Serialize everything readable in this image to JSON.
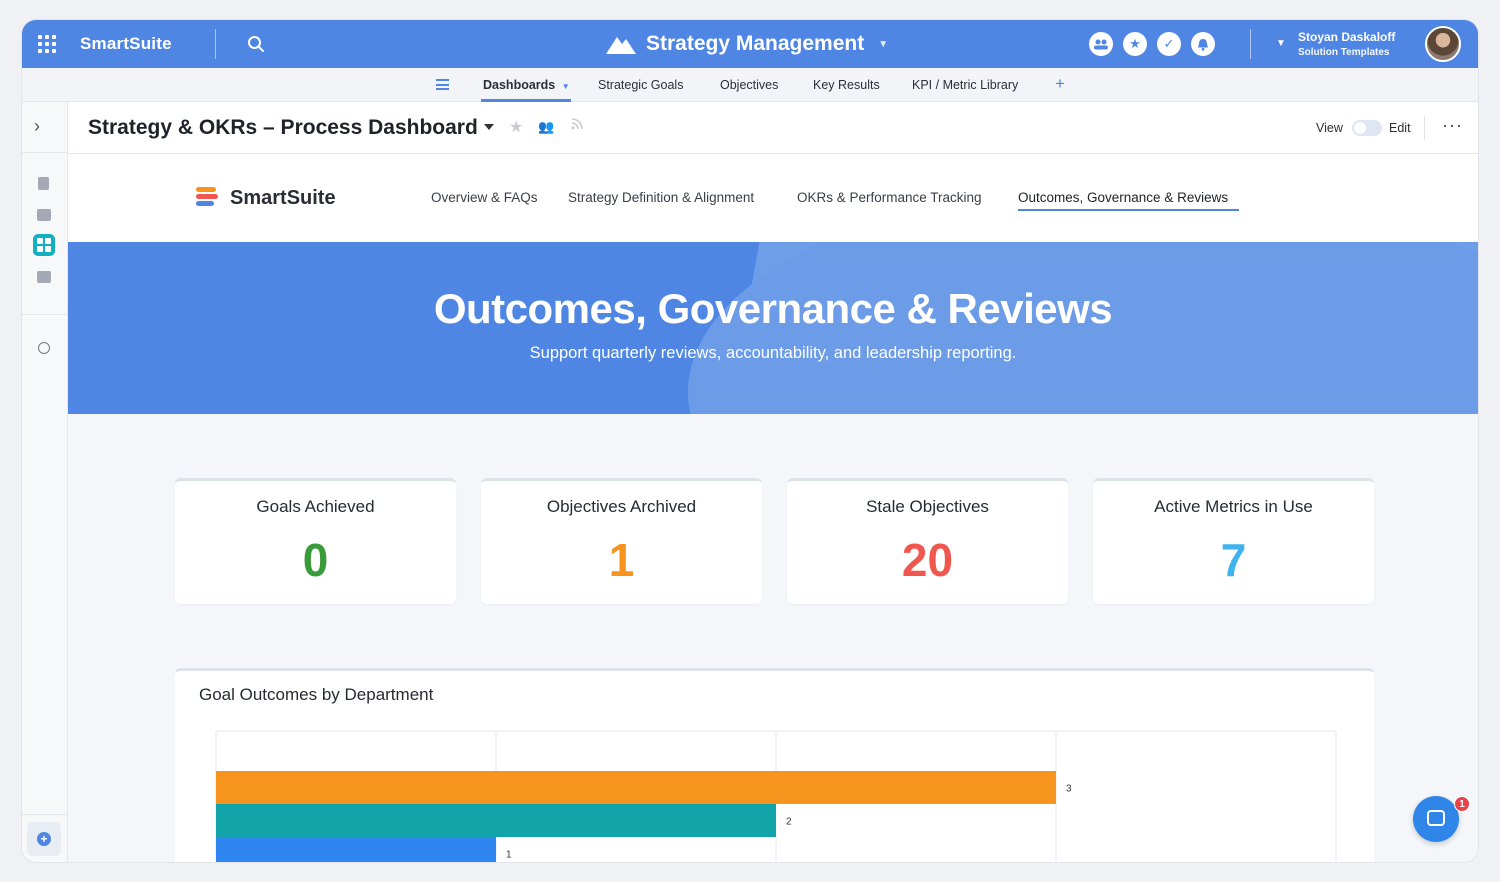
{
  "app": {
    "brand": "SmartSuite",
    "solution_title": "Strategy Management",
    "user_name": "Stoyan Daskaloff",
    "user_role": "Solution Templates"
  },
  "nav": {
    "items": [
      "Dashboards",
      "Strategic Goals",
      "Objectives",
      "Key Results",
      "KPI / Metric Library"
    ],
    "active": "Dashboards",
    "add_label": "+"
  },
  "dashboard": {
    "title": "Strategy & OKRs – Process Dashboard",
    "view_label": "View",
    "edit_label": "Edit",
    "more_label": "···"
  },
  "subnav": {
    "logo_text": "SmartSuite",
    "items": [
      "Overview & FAQs",
      "Strategy Definition & Alignment",
      "OKRs & Performance Tracking",
      "Outcomes, Governance & Reviews"
    ],
    "active": "Outcomes, Governance & Reviews"
  },
  "hero": {
    "title": "Outcomes, Governance & Reviews",
    "subtitle": "Support quarterly reviews, accountability, and leadership reporting."
  },
  "metrics": [
    {
      "label": "Goals Achieved",
      "value": "0",
      "color": "#3a9b3a"
    },
    {
      "label": "Objectives Archived",
      "value": "1",
      "color": "#f7941d"
    },
    {
      "label": "Stale Objectives",
      "value": "20",
      "color": "#f0584f"
    },
    {
      "label": "Active Metrics in Use",
      "value": "7",
      "color": "#3fb3ee"
    }
  ],
  "chart_card": {
    "title": "Goal Outcomes by Department"
  },
  "chart_data": {
    "type": "bar",
    "orientation": "horizontal",
    "title": "Goal Outcomes by Department",
    "values": [
      3,
      2,
      1
    ],
    "colors": [
      "#f7941d",
      "#11a4a8",
      "#2f86f0"
    ],
    "xlim": [
      0,
      4
    ],
    "grid": true
  },
  "chat": {
    "badge": "1"
  }
}
